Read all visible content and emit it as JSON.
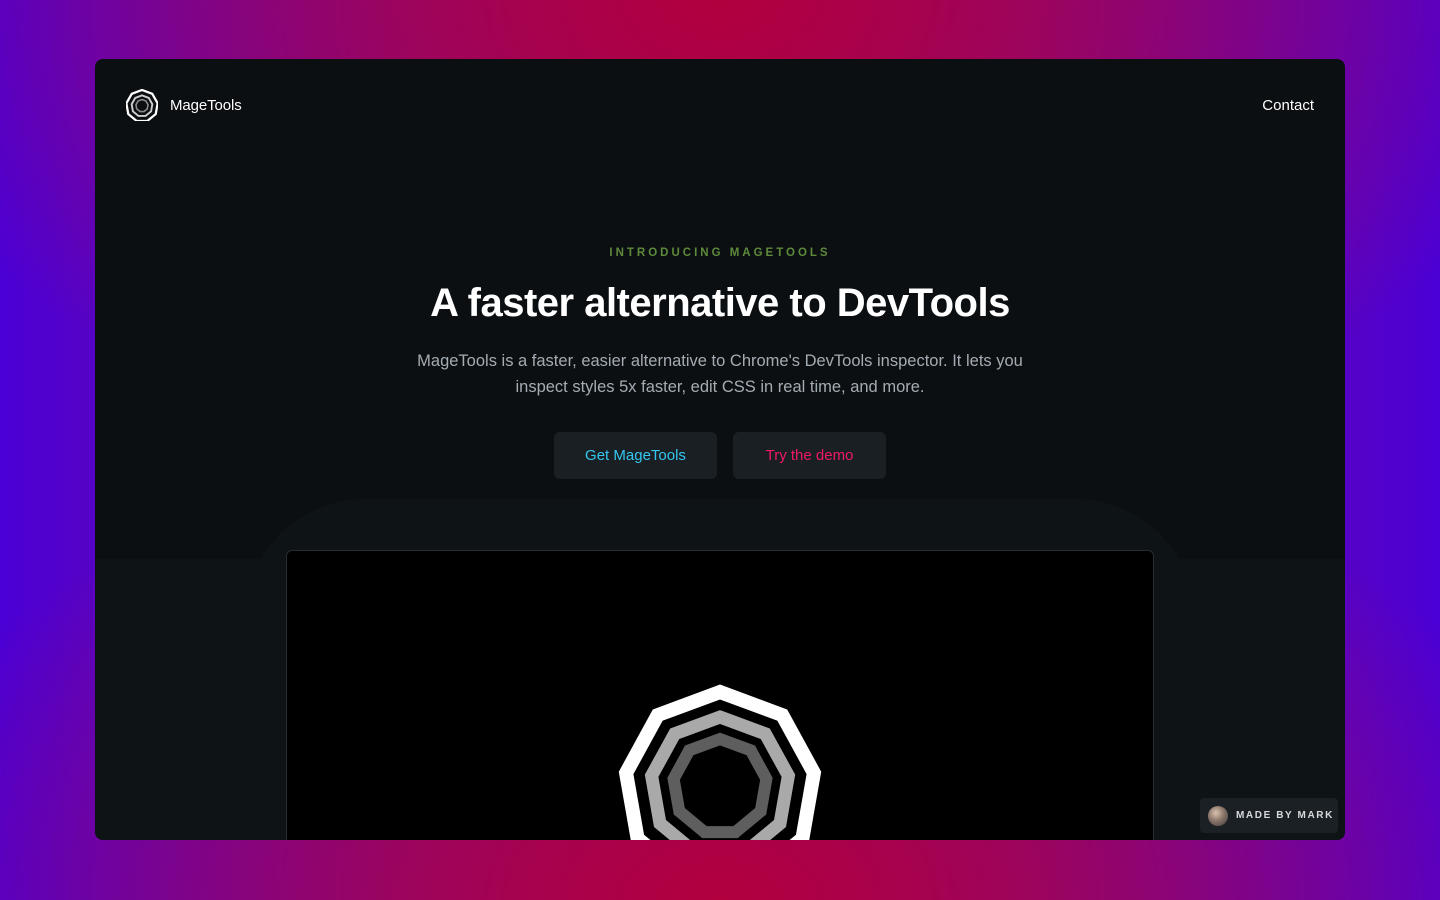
{
  "nav": {
    "brand_name": "MageTools",
    "contact_label": "Contact"
  },
  "hero": {
    "eyebrow": "INTRODUCING MAGETOOLS",
    "headline": "A faster alternative to DevTools",
    "subtext": "MageTools is a faster, easier alternative to Chrome's DevTools inspector. It lets you inspect styles 5x faster, edit CSS in real time, and more.",
    "primary_button": "Get MageTools",
    "secondary_button": "Try the demo"
  },
  "badge": {
    "label": "MADE BY MARK"
  },
  "icons": {
    "brand": "magetools-logo-icon",
    "demo": "magetools-logo-icon",
    "badge": "avatar"
  },
  "colors": {
    "eyebrow": "#5e8a3c",
    "primary_button_text": "#34c6f0",
    "secondary_button_text": "#f0186a",
    "window_background": "#0b0f12"
  }
}
